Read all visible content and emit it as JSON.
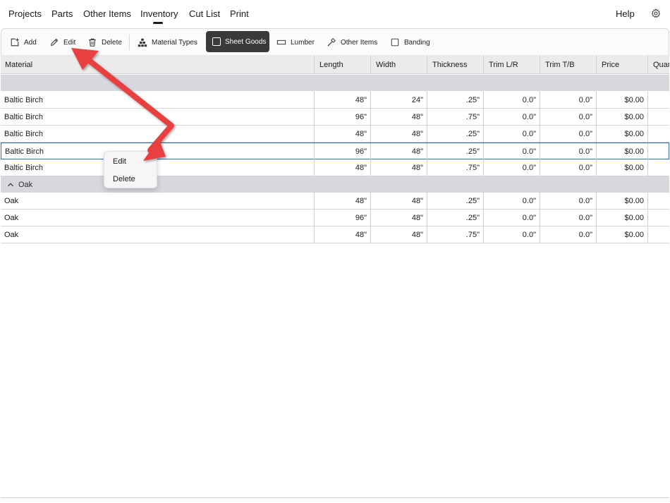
{
  "nav": {
    "tabs": [
      "Projects",
      "Parts",
      "Other Items",
      "Inventory",
      "Cut List",
      "Print"
    ],
    "active_tab": "Inventory",
    "help_label": "Help"
  },
  "toolbar": {
    "add_label": "Add",
    "edit_label": "Edit",
    "delete_label": "Delete",
    "material_types_label": "Material Types",
    "sheet_goods_label": "Sheet Goods",
    "lumber_label": "Lumber",
    "other_items_label": "Other Items",
    "banding_label": "Banding"
  },
  "table": {
    "columns": [
      "Material",
      "Length",
      "Width",
      "Thickness",
      "Trim L/R",
      "Trim T/B",
      "Price",
      "Quan"
    ],
    "groups": [
      {
        "name": "",
        "rows": [
          [
            "Baltic Birch",
            "48\"",
            "24\"",
            ".25\"",
            "0.0\"",
            "0.0\"",
            "$0.00"
          ],
          [
            "Baltic Birch",
            "96\"",
            "48\"",
            ".75\"",
            "0.0\"",
            "0.0\"",
            "$0.00"
          ],
          [
            "Baltic Birch",
            "48\"",
            "48\"",
            ".25\"",
            "0.0\"",
            "0.0\"",
            "$0.00"
          ],
          [
            "Baltic Birch",
            "96\"",
            "48\"",
            ".25\"",
            "0.0\"",
            "0.0\"",
            "$0.00"
          ],
          [
            "Baltic Birch",
            "48\"",
            "48\"",
            ".75\"",
            "0.0\"",
            "0.0\"",
            "$0.00"
          ]
        ]
      },
      {
        "name": "Oak",
        "rows": [
          [
            "Oak",
            "48\"",
            "48\"",
            ".25\"",
            "0.0\"",
            "0.0\"",
            "$0.00"
          ],
          [
            "Oak",
            "96\"",
            "48\"",
            ".25\"",
            "0.0\"",
            "0.0\"",
            "$0.00"
          ],
          [
            "Oak",
            "48\"",
            "48\"",
            ".75\"",
            "0.0\"",
            "0.0\"",
            "$0.00"
          ]
        ]
      }
    ],
    "selected_row": "Baltic Birch 96\" x 48\" x .25\""
  },
  "context_menu": {
    "items": [
      "Edit",
      "Delete"
    ]
  },
  "colors": {
    "selection_border": "#2f6fb5",
    "annotation_arrow": "#e8403f",
    "active_toggle": "#3a3a3a",
    "group_header": "#d6d8dd"
  },
  "icons": [
    "add-icon",
    "pencil-icon",
    "trash-icon",
    "material-types-icon",
    "checkbox-icon",
    "lumber-icon",
    "hammer-icon",
    "gear-icon",
    "chevron-up-icon"
  ]
}
